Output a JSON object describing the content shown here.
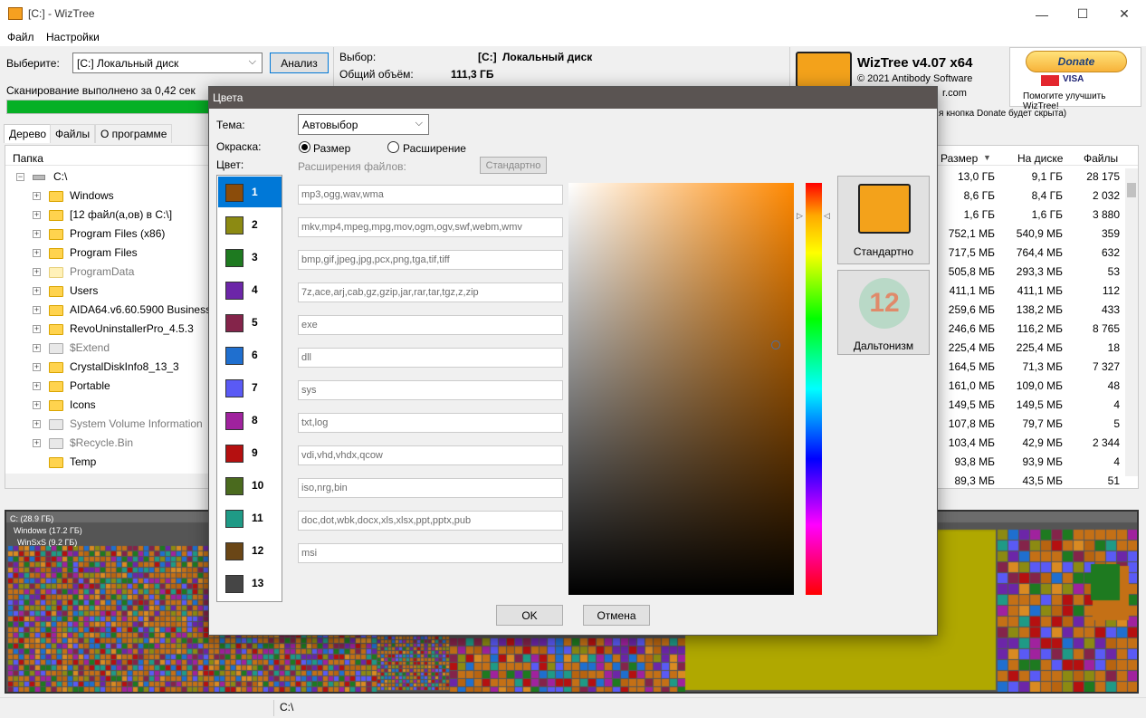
{
  "window": {
    "title": "[C:]  - WizTree",
    "minimize": "—",
    "maximize": "☐",
    "close": "✕"
  },
  "menu": [
    "Файл",
    "Настройки"
  ],
  "top": {
    "select_label": "Выберите:",
    "drive": "[C:] Локальный диск",
    "analyze": "Анализ",
    "scan_status": "Сканирование выполнено за 0,42 сек",
    "selection_label": "Выбор:",
    "selection_value": "[C:]",
    "selection_name": "Локальный диск",
    "total_label": "Общий объём:",
    "total_value": "111,3 ГБ",
    "brand_title": "WizTree v4.07 x64",
    "brand_copy": "© 2021 Antibody Software",
    "brand_site": "r.com",
    "donate": "Donate",
    "donate_cards": "VISA",
    "donate_help": "Помогите улучшить WizTree!",
    "donate_note": "я кнопка Donate будет скрыта)",
    "scan_progress": 1.0
  },
  "tabs": [
    "Дерево",
    "Файлы",
    "О программе"
  ],
  "tree": {
    "col_folder": "Папка",
    "col_size": "Размер",
    "col_disk": "На диске",
    "col_files": "Файлы",
    "root": "C:\\",
    "rows": [
      {
        "name": "Windows",
        "size": "8,6 ГБ",
        "disk": "8,4 ГБ",
        "files": "2 032",
        "gray": false
      },
      {
        "name": "[12 файл(а,ов) в C:\\]",
        "size": "1,6 ГБ",
        "disk": "1,6 ГБ",
        "files": "3 880",
        "gray": false
      },
      {
        "name": "Program Files (x86)",
        "size": "752,1 МБ",
        "disk": "540,9 МБ",
        "files": "359",
        "gray": false
      },
      {
        "name": "Program Files",
        "size": "717,5 МБ",
        "disk": "764,4 МБ",
        "files": "632",
        "gray": false
      },
      {
        "name": "ProgramData",
        "size": "505,8 МБ",
        "disk": "293,3 МБ",
        "files": "53",
        "gray": true
      },
      {
        "name": "Users",
        "size": "411,1 МБ",
        "disk": "411,1 МБ",
        "files": "112",
        "gray": false
      },
      {
        "name": "AIDA64.v6.60.5900 Business",
        "size": "259,6 МБ",
        "disk": "138,2 МБ",
        "files": "433",
        "gray": false
      },
      {
        "name": "RevoUninstallerPro_4.5.3",
        "size": "246,6 МБ",
        "disk": "116,2 МБ",
        "files": "8 765",
        "gray": false
      },
      {
        "name": "$Extend",
        "size": "225,4 МБ",
        "disk": "225,4 МБ",
        "files": "18",
        "gray": true
      },
      {
        "name": "CrystalDiskInfo8_13_3",
        "size": "164,5 МБ",
        "disk": "71,3 МБ",
        "files": "7 327",
        "gray": false
      },
      {
        "name": "Portable",
        "size": "161,0 МБ",
        "disk": "109,0 МБ",
        "files": "48",
        "gray": false
      },
      {
        "name": "Icons",
        "size": "149,5 МБ",
        "disk": "149,5 МБ",
        "files": "4",
        "gray": false
      },
      {
        "name": "System Volume Information",
        "size": "107,8 МБ",
        "disk": "79,7 МБ",
        "files": "5",
        "gray": true
      },
      {
        "name": "$Recycle.Bin",
        "size": "103,4 МБ",
        "disk": "42,9 МБ",
        "files": "2 344",
        "gray": true
      },
      {
        "name": "Temp",
        "size": "93,8 МБ",
        "disk": "93,9 МБ",
        "files": "4",
        "gray": false
      },
      {
        "name": "",
        "size": "89,3 МБ",
        "disk": "43,5 МБ",
        "files": "51",
        "gray": false
      }
    ],
    "root_size": "13,0 ГБ",
    "root_disk": "9,1 ГБ",
    "root_files": "28 175"
  },
  "treemap": {
    "label_c": "C: (28.9 ГБ)",
    "label_windows": "Windows (17.2 ГБ)",
    "label_winsxs": "WinSxS (9.2 ГБ)"
  },
  "status": {
    "path": "C:\\"
  },
  "dialog": {
    "title": "Цвета",
    "theme_label": "Тема:",
    "theme_value": "Автовыбор",
    "coloring_label": "Окраска:",
    "radio_size": "Размер",
    "radio_ext": "Расширение",
    "color_label": "Цвет:",
    "ext_label": "Расширения файлов:",
    "default_btn": "Стандартно",
    "scheme_default": "Стандартно",
    "scheme_colorblind": "Дальтонизм",
    "colorblind_number": "12",
    "ok": "OK",
    "cancel": "Отмена",
    "swatches": [
      {
        "n": "1",
        "color": "#8b4c0a",
        "ext": "mp3,ogg,wav,wma"
      },
      {
        "n": "2",
        "color": "#8c8a12",
        "ext": "mkv,mp4,mpeg,mpg,mov,ogm,ogv,swf,webm,wmv"
      },
      {
        "n": "3",
        "color": "#1e7a20",
        "ext": "bmp,gif,jpeg,jpg,pcx,png,tga,tif,tiff"
      },
      {
        "n": "4",
        "color": "#6c26a8",
        "ext": "7z,ace,arj,cab,gz,gzip,jar,rar,tar,tgz,z,zip"
      },
      {
        "n": "5",
        "color": "#84244a",
        "ext": "exe"
      },
      {
        "n": "6",
        "color": "#1f6fcf",
        "ext": "dll"
      },
      {
        "n": "7",
        "color": "#5a5af5",
        "ext": "sys"
      },
      {
        "n": "8",
        "color": "#a0229e",
        "ext": "txt,log"
      },
      {
        "n": "9",
        "color": "#b51010",
        "ext": "vdi,vhd,vhdx,qcow"
      },
      {
        "n": "10",
        "color": "#4a6a1e",
        "ext": "iso,nrg,bin"
      },
      {
        "n": "11",
        "color": "#1f9a86",
        "ext": "doc,dot,wbk,docx,xls,xlsx,ppt,pptx,pub"
      },
      {
        "n": "12",
        "color": "#6a4616",
        "ext": "msi"
      },
      {
        "n": "13",
        "color": "#454545",
        "ext": ""
      }
    ],
    "picker_hue": "#ff8800"
  }
}
